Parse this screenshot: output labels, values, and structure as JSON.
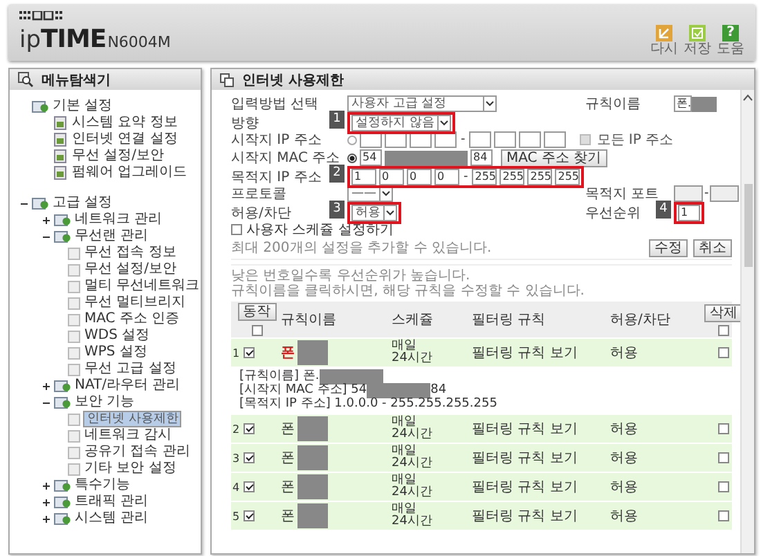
{
  "header": {
    "brand_prefix": "ip",
    "brand": "TIME",
    "model": "N6004M",
    "buttons": [
      {
        "label": "다시",
        "kind": "reload"
      },
      {
        "label": "저장",
        "kind": "save"
      },
      {
        "label": "도움",
        "kind": "help",
        "glyph": "?"
      }
    ]
  },
  "sidebar": {
    "title": "메뉴탐색기",
    "items": [
      {
        "label": "기본 설정",
        "children": [
          {
            "label": "시스템 요약 정보"
          },
          {
            "label": "인터넷 연결 설정"
          },
          {
            "label": "무선 설정/보안"
          },
          {
            "label": "펌웨어 업그레이드"
          }
        ]
      },
      {
        "label": "고급 설정",
        "expanded": true,
        "children": [
          {
            "label": "네트워크 관리",
            "expanded": false
          },
          {
            "label": "무선랜 관리",
            "expanded": true,
            "children": [
              {
                "label": "무선 접속 정보"
              },
              {
                "label": "무선 설정/보안"
              },
              {
                "label": "멀티 무선네트워크"
              },
              {
                "label": "무선 멀티브리지"
              },
              {
                "label": "MAC 주소 인증"
              },
              {
                "label": "WDS 설정"
              },
              {
                "label": "WPS 설정"
              },
              {
                "label": "무선 고급 설정"
              }
            ]
          },
          {
            "label": "NAT/라우터 관리",
            "expanded": false
          },
          {
            "label": "보안 기능",
            "expanded": true,
            "children": [
              {
                "label": "인터넷 사용제한",
                "selected": true
              },
              {
                "label": "네트워크 감시",
                "selected": false
              },
              {
                "label": "공유기 접속 관리",
                "selected": false
              },
              {
                "label": "기타 보안 설정",
                "selected": false
              }
            ]
          },
          {
            "label": "특수기능",
            "expanded": false
          },
          {
            "label": "트래픽 관리",
            "expanded": false
          },
          {
            "label": "시스템 관리",
            "expanded": false
          }
        ]
      }
    ]
  },
  "main": {
    "title": "인터넷 사용제한",
    "form": {
      "input_method": {
        "label": "입력방법 선택",
        "value": "사용자 고급 설정"
      },
      "rule_name": {
        "label": "규칙이름",
        "value": "폰."
      },
      "direction": {
        "label": "방향",
        "value": "설정하지 않음",
        "callout": "1"
      },
      "source_ip": {
        "label": "시작지 IP 주소",
        "selected": false,
        "separator": "-",
        "all_label": "모든 IP 주소",
        "all_checked": false
      },
      "source_mac": {
        "label": "시작지 MAC 주소",
        "selected": true,
        "first": "54",
        "last": "84",
        "button": "MAC 주소 찾기"
      },
      "dest_ip": {
        "label": "목적지 IP 주소",
        "start": [
          "1",
          "0",
          "0",
          "0"
        ],
        "separator": "-",
        "end": [
          "255",
          "255",
          "255",
          "255"
        ],
        "callout": "2"
      },
      "protocol": {
        "label": "프로토콜",
        "value": "——"
      },
      "dest_port": {
        "label": "목적지 포트",
        "separator": "-"
      },
      "action": {
        "label": "허용/차단",
        "value": "허용",
        "callout": "3"
      },
      "priority": {
        "label": "우선순위",
        "value": "1",
        "callout": "4"
      },
      "schedule": {
        "label": "사용자 스케쥴 설정하기",
        "checked": false
      },
      "limit_note": "최대 200개의 설정을 추가할 수 있습니다.",
      "buttons": [
        "수정",
        "취소"
      ]
    },
    "notes": [
      "낮은 번호일수록 우선순위가 높습니다.",
      "규칙이름을 클릭하시면, 해당 규칙을 수정할 수 있습니다."
    ],
    "table": {
      "action_button": "동작",
      "action_all_checked": false,
      "columns": [
        "규칙이름",
        "스케쥴",
        "필터링 규칙",
        "허용/차단"
      ],
      "delete_button": "삭제",
      "delete_all_checked": false,
      "rows": [
        {
          "number": "1",
          "active": true,
          "name": "폰",
          "editing": true,
          "schedule": [
            "매일",
            "24시간"
          ],
          "filter": "필터링 규칙 보기",
          "action": "허용",
          "delete": false,
          "details": [
            {
              "text": "[규칙이름] 폰.",
              "redacted": true
            },
            {
              "text": "[시작지 MAC 주소] 54",
              "redacted": true,
              "tail": "84"
            },
            {
              "text": "[목적지 IP 주소] 1.0.0.0 - 255.255.255.255"
            }
          ]
        },
        {
          "number": "2",
          "active": true,
          "name": "폰",
          "editing": false,
          "schedule": [
            "매일",
            "24시간"
          ],
          "filter": "필터링 규칙 보기",
          "action": "허용",
          "delete": false
        },
        {
          "number": "3",
          "active": true,
          "name": "폰",
          "editing": false,
          "schedule": [
            "매일",
            "24시간"
          ],
          "filter": "필터링 규칙 보기",
          "action": "허용",
          "delete": false
        },
        {
          "number": "4",
          "active": true,
          "name": "폰",
          "editing": false,
          "schedule": [
            "매일",
            "24시간"
          ],
          "filter": "필터링 규칙 보기",
          "action": "허용",
          "delete": false
        },
        {
          "number": "5",
          "active": true,
          "name": "폰",
          "editing": false,
          "schedule": [
            "매일",
            "24시간"
          ],
          "filter": "필터링 규칙 보기",
          "action": "허용",
          "delete": false
        }
      ]
    }
  }
}
